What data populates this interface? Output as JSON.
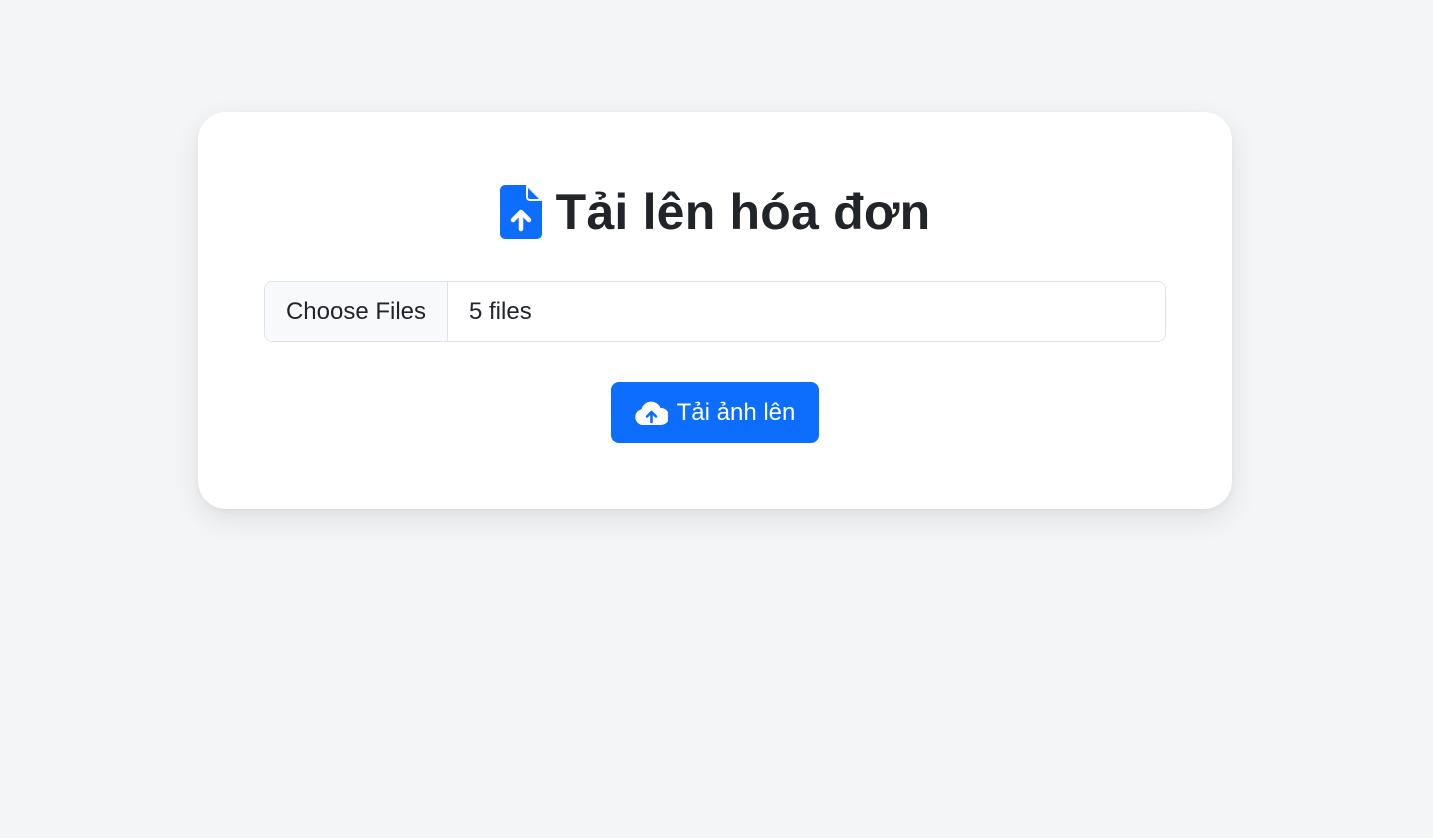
{
  "page": {
    "title": "Tải lên hóa đơn",
    "title_icon": "file-upload-icon"
  },
  "file_input": {
    "button_label": "Choose Files",
    "status_text": "5 files"
  },
  "upload_button": {
    "label": "Tải ảnh lên",
    "icon": "cloud-upload-icon"
  },
  "colors": {
    "accent": "#0d6efd",
    "background": "#f4f5f7",
    "card": "#ffffff",
    "text": "#212529"
  }
}
